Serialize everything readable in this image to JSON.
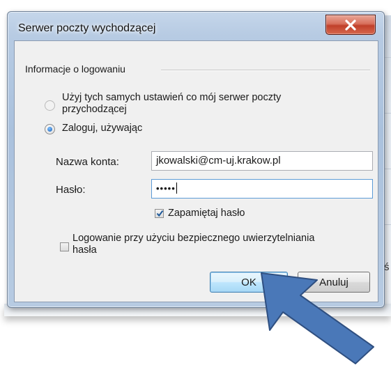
{
  "dialog": {
    "title": "Serwer poczty wychodzącej",
    "close_label": "X"
  },
  "group": {
    "legend": "Informacje o logowaniu"
  },
  "options": {
    "same_settings_line1": "Użyj tych samych ustawień co mój serwer poczty",
    "same_settings_line2": "przychodzącej",
    "login_using": "Zaloguj, używając"
  },
  "fields": {
    "account_label": "Nazwa konta:",
    "account_value": "jkowalski@cm-uj.krakow.pl",
    "password_label": "Hasło:",
    "password_value": "•••••"
  },
  "checkboxes": {
    "remember_password": "Zapamiętaj hasło",
    "secure_auth_line1": "Logowanie przy użyciu bezpiecznego uwierzytelniania",
    "secure_auth_line2": "hasła"
  },
  "buttons": {
    "ok": "OK",
    "cancel": "Anuluj"
  },
  "background": {
    "edge_char": "ś"
  },
  "colors": {
    "arrow_fill": "#4a78b8",
    "arrow_stroke": "#2f4f80"
  }
}
